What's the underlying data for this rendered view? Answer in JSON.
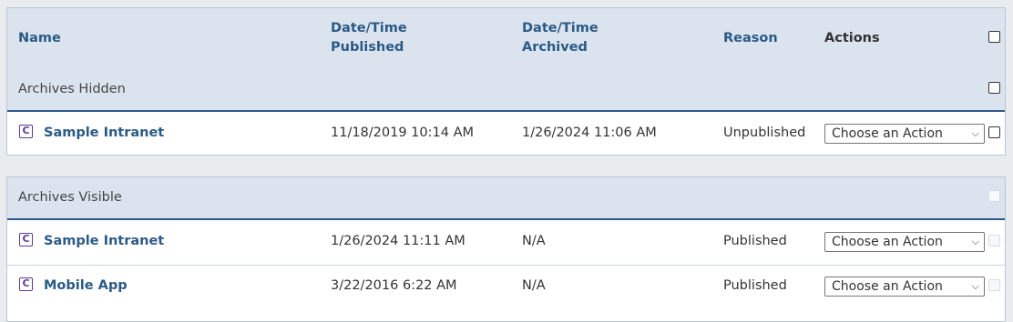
{
  "columns": {
    "name": "Name",
    "published_line1": "Date/Time",
    "published_line2": "Published",
    "archived_line1": "Date/Time",
    "archived_line2": "Archived",
    "reason": "Reason",
    "actions": "Actions"
  },
  "groups": [
    {
      "title": "Archives Hidden",
      "rows": [
        {
          "name": "Sample Intranet",
          "published": "11/18/2019 10:14 AM",
          "archived": "1/26/2024 11:06 AM",
          "reason": "Unpublished",
          "action": "Choose an Action"
        }
      ]
    },
    {
      "title": "Archives Visible",
      "rows": [
        {
          "name": "Sample Intranet",
          "published": "1/26/2024 11:11 AM",
          "archived": "N/A",
          "reason": "Published",
          "action": "Choose an Action"
        },
        {
          "name": "Mobile App",
          "published": "3/22/2016 6:22 AM",
          "archived": "N/A",
          "reason": "Published",
          "action": "Choose an Action"
        }
      ]
    }
  ],
  "icons": {
    "app": "c-app-icon",
    "dropdown": "chevron-down-icon"
  },
  "colors": {
    "header_bg": "#dbe4ee",
    "link": "#2a5a86",
    "divider": "#2d5a87",
    "icon": "#5b3b97"
  }
}
